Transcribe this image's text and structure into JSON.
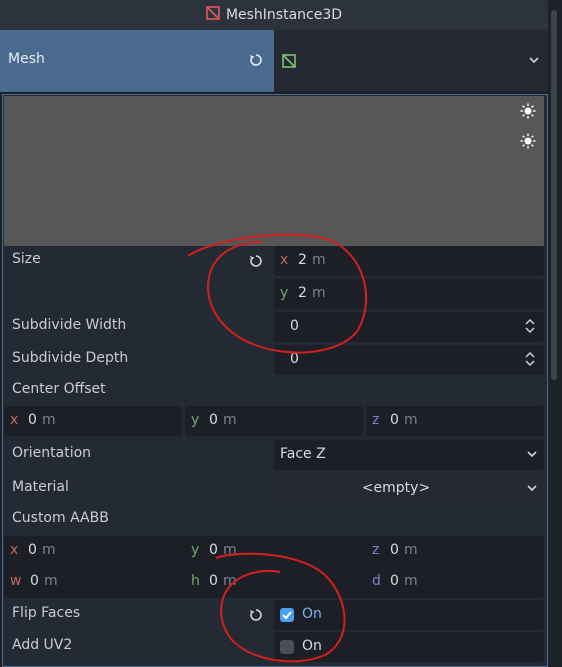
{
  "header": {
    "title": "MeshInstance3D"
  },
  "mesh": {
    "label": "Mesh"
  },
  "properties": {
    "size": {
      "label": "Size",
      "x": "2",
      "y": "2",
      "unit": "m"
    },
    "subdivide_width": {
      "label": "Subdivide Width",
      "value": "0"
    },
    "subdivide_depth": {
      "label": "Subdivide Depth",
      "value": "0"
    },
    "center_offset": {
      "label": "Center Offset",
      "x": "0",
      "y": "0",
      "z": "0",
      "unit": "m"
    },
    "orientation": {
      "label": "Orientation",
      "value": "Face Z"
    },
    "material": {
      "label": "Material",
      "value": "<empty>"
    },
    "custom_aabb": {
      "label": "Custom AABB",
      "x": "0",
      "y": "0",
      "z": "0",
      "w": "0",
      "h": "0",
      "d": "0",
      "unit": "m"
    },
    "flip_faces": {
      "label": "Flip Faces",
      "value": "On",
      "checked": true
    },
    "add_uv2": {
      "label": "Add UV2",
      "value": "On",
      "checked": false
    }
  },
  "axes": {
    "x": "x",
    "y": "y",
    "z": "z",
    "w": "w",
    "h": "h",
    "d": "d"
  },
  "colors": {
    "accent": "#4a6a8f",
    "annotation": "#d21f1f",
    "check_on": "#4a9ff0"
  },
  "icons": [
    "mesh-instance-icon",
    "mesh-icon",
    "revert-icon",
    "chevron-down-icon",
    "spinner-icon",
    "sun-icon"
  ]
}
